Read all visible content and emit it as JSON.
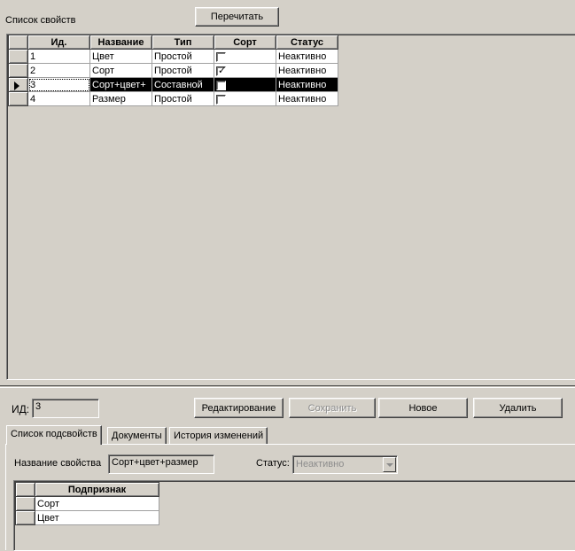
{
  "properties_list": {
    "label": "Список свойств",
    "refresh_button": "Перечитать",
    "columns": [
      "Ид.",
      "Название",
      "Тип",
      "Сорт",
      "Статус"
    ],
    "rows": [
      {
        "id": "1",
        "name": "Цвет",
        "type": "Простой",
        "sort": false,
        "status": "Неактивно"
      },
      {
        "id": "2",
        "name": "Сорт",
        "type": "Простой",
        "sort": true,
        "status": "Неактивно"
      },
      {
        "id": "3",
        "name": "Сорт+цвет+",
        "type": "Составной",
        "sort": false,
        "status": "Неактивно",
        "selected": true
      },
      {
        "id": "4",
        "name": "Размер",
        "type": "Простой",
        "sort": false,
        "status": "Неактивно"
      }
    ]
  },
  "detail": {
    "id_label": "ИД:",
    "id_value": "3",
    "buttons": {
      "edit": "Редактирование",
      "save": "Сохранить",
      "new": "Новое",
      "delete": "Удалить"
    },
    "tabs": [
      "Список подсвойств",
      "Документы",
      "История изменений"
    ],
    "active_tab": 0,
    "property_name_label": "Название свойства",
    "property_name_value": "Сорт+цвет+размер",
    "status_label": "Статус:",
    "status_value": "Неактивно",
    "subproperties": {
      "column": "Подпризнак",
      "rows": [
        "Сорт",
        "Цвет"
      ]
    }
  },
  "icons": {
    "row_indicator": "triangle-right-icon",
    "dropdown": "chevron-down-icon",
    "checkbox_mark": "checkmark-icon"
  }
}
